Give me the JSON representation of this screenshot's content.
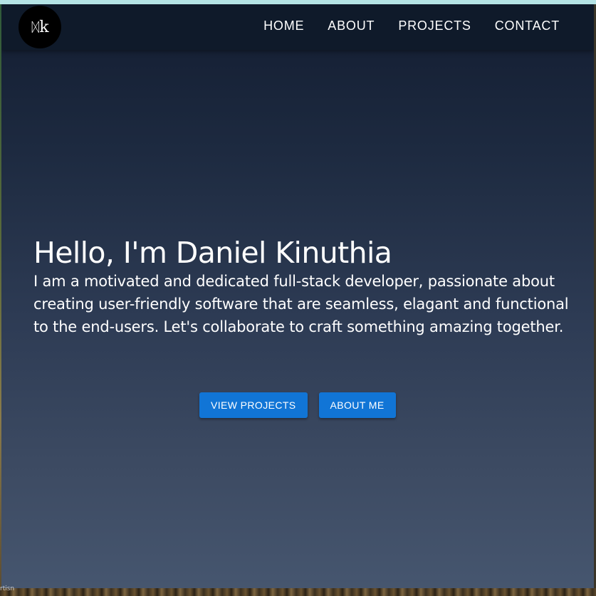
{
  "brand": {
    "logo_text": "k",
    "logo_symbol": "ᛞ"
  },
  "nav": {
    "items": [
      {
        "label": "HOME"
      },
      {
        "label": "ABOUT"
      },
      {
        "label": "PROJECTS"
      },
      {
        "label": "CONTACT"
      }
    ]
  },
  "hero": {
    "heading": "Hello, I'm Daniel Kinuthia",
    "description": "I am a motivated and dedicated full-stack developer, passionate about creating user-friendly software that are seamless, elagant and functional to the end-users. Let's collaborate to craft something amazing together.",
    "buttons": {
      "view_projects": "VIEW PROJECTS",
      "about_me": "ABOUT ME"
    }
  },
  "background_snippet": "rtisn",
  "colors": {
    "accent": "#1175d6",
    "nav_bg": "#0f1a2a",
    "top_strip": "#b4e3e5"
  }
}
